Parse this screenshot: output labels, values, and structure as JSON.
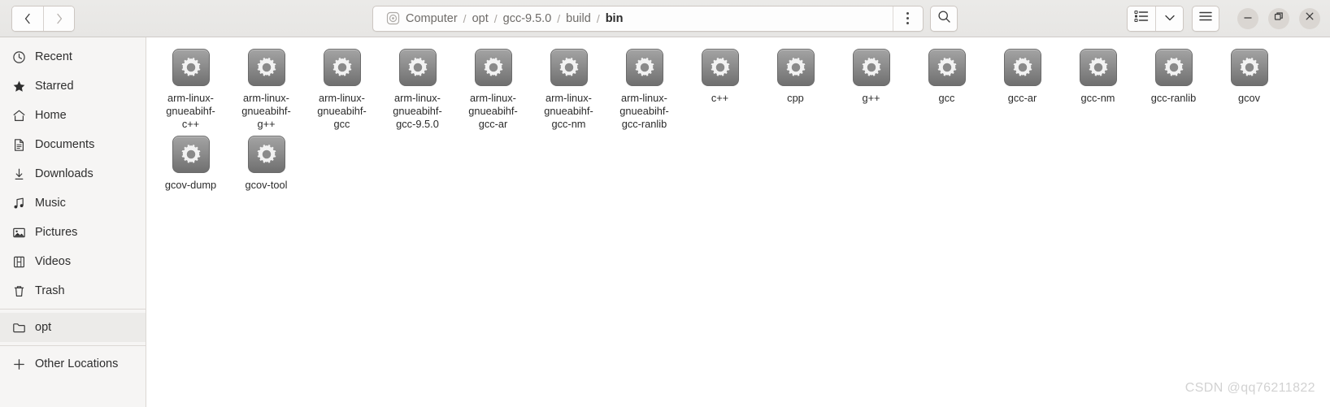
{
  "header": {
    "nav": {
      "back_label": "‹",
      "forward_label": "›"
    },
    "breadcrumbs": [
      {
        "label": "Computer",
        "icon": "drive-icon",
        "active": false
      },
      {
        "label": "opt",
        "active": false
      },
      {
        "label": "gcc-9.5.0",
        "active": false
      },
      {
        "label": "build",
        "active": false
      },
      {
        "label": "bin",
        "active": true
      }
    ],
    "separator": "/",
    "menu_icon": "vertical-dots-icon",
    "search_icon": "search-icon",
    "view_icon": "list-view-icon",
    "view_dropdown_icon": "chevron-down-icon",
    "hamburger_icon": "hamburger-menu-icon",
    "window_buttons": {
      "minimize": "minimize-icon",
      "maximize": "maximize-icon",
      "close": "close-icon"
    }
  },
  "sidebar": {
    "items": [
      {
        "label": "Recent",
        "icon": "clock-icon"
      },
      {
        "label": "Starred",
        "icon": "star-icon"
      },
      {
        "label": "Home",
        "icon": "home-icon"
      },
      {
        "label": "Documents",
        "icon": "document-icon"
      },
      {
        "label": "Downloads",
        "icon": "download-icon"
      },
      {
        "label": "Music",
        "icon": "music-icon"
      },
      {
        "label": "Pictures",
        "icon": "picture-icon"
      },
      {
        "label": "Videos",
        "icon": "video-icon"
      },
      {
        "label": "Trash",
        "icon": "trash-icon"
      }
    ],
    "devices": [
      {
        "label": "opt",
        "icon": "folder-icon"
      }
    ],
    "other": {
      "label": "Other Locations",
      "icon": "plus-icon"
    }
  },
  "files": {
    "icon_type": "executable-gear-icon",
    "rows": [
      [
        {
          "name": "arm-linux-gnueabihf-c++",
          "display": "arm-linux-\ngnueabihf-\nc++"
        },
        {
          "name": "arm-linux-gnueabihf-g++",
          "display": "arm-linux-\ngnueabihf-\ng++"
        },
        {
          "name": "arm-linux-gnueabihf-gcc",
          "display": "arm-linux-\ngnueabihf-\ngcc"
        },
        {
          "name": "arm-linux-gnueabihf-gcc-9.5.0",
          "display": "arm-linux-\ngnueabihf-\ngcc-9.5.0"
        },
        {
          "name": "arm-linux-gnueabihf-gcc-ar",
          "display": "arm-linux-\ngnueabihf-\ngcc-ar"
        },
        {
          "name": "arm-linux-gnueabihf-gcc-nm",
          "display": "arm-linux-\ngnueabihf-\ngcc-nm"
        },
        {
          "name": "arm-linux-gnueabihf-gcc-ranlib",
          "display": "arm-linux-\ngnueabihf-\ngcc-ranlib"
        },
        {
          "name": "c++",
          "display": "c++"
        },
        {
          "name": "cpp",
          "display": "cpp"
        },
        {
          "name": "g++",
          "display": "g++"
        },
        {
          "name": "gcc",
          "display": "gcc"
        },
        {
          "name": "gcc-ar",
          "display": "gcc-ar"
        },
        {
          "name": "gcc-nm",
          "display": "gcc-nm"
        },
        {
          "name": "gcc-ranlib",
          "display": "gcc-ranlib"
        },
        {
          "name": "gcov",
          "display": "gcov"
        }
      ],
      [
        {
          "name": "gcov-dump",
          "display": "gcov-dump"
        },
        {
          "name": "gcov-tool",
          "display": "gcov-tool"
        }
      ]
    ]
  },
  "watermark": {
    "text": "CSDN @qq76211822"
  },
  "colors": {
    "headerbar": "#e7e6e4",
    "sidebar": "#f6f5f4",
    "content": "#ffffff",
    "text": "#2b2b2b",
    "muted_text": "#6e6b68",
    "watermark": "#d2d2d2"
  }
}
